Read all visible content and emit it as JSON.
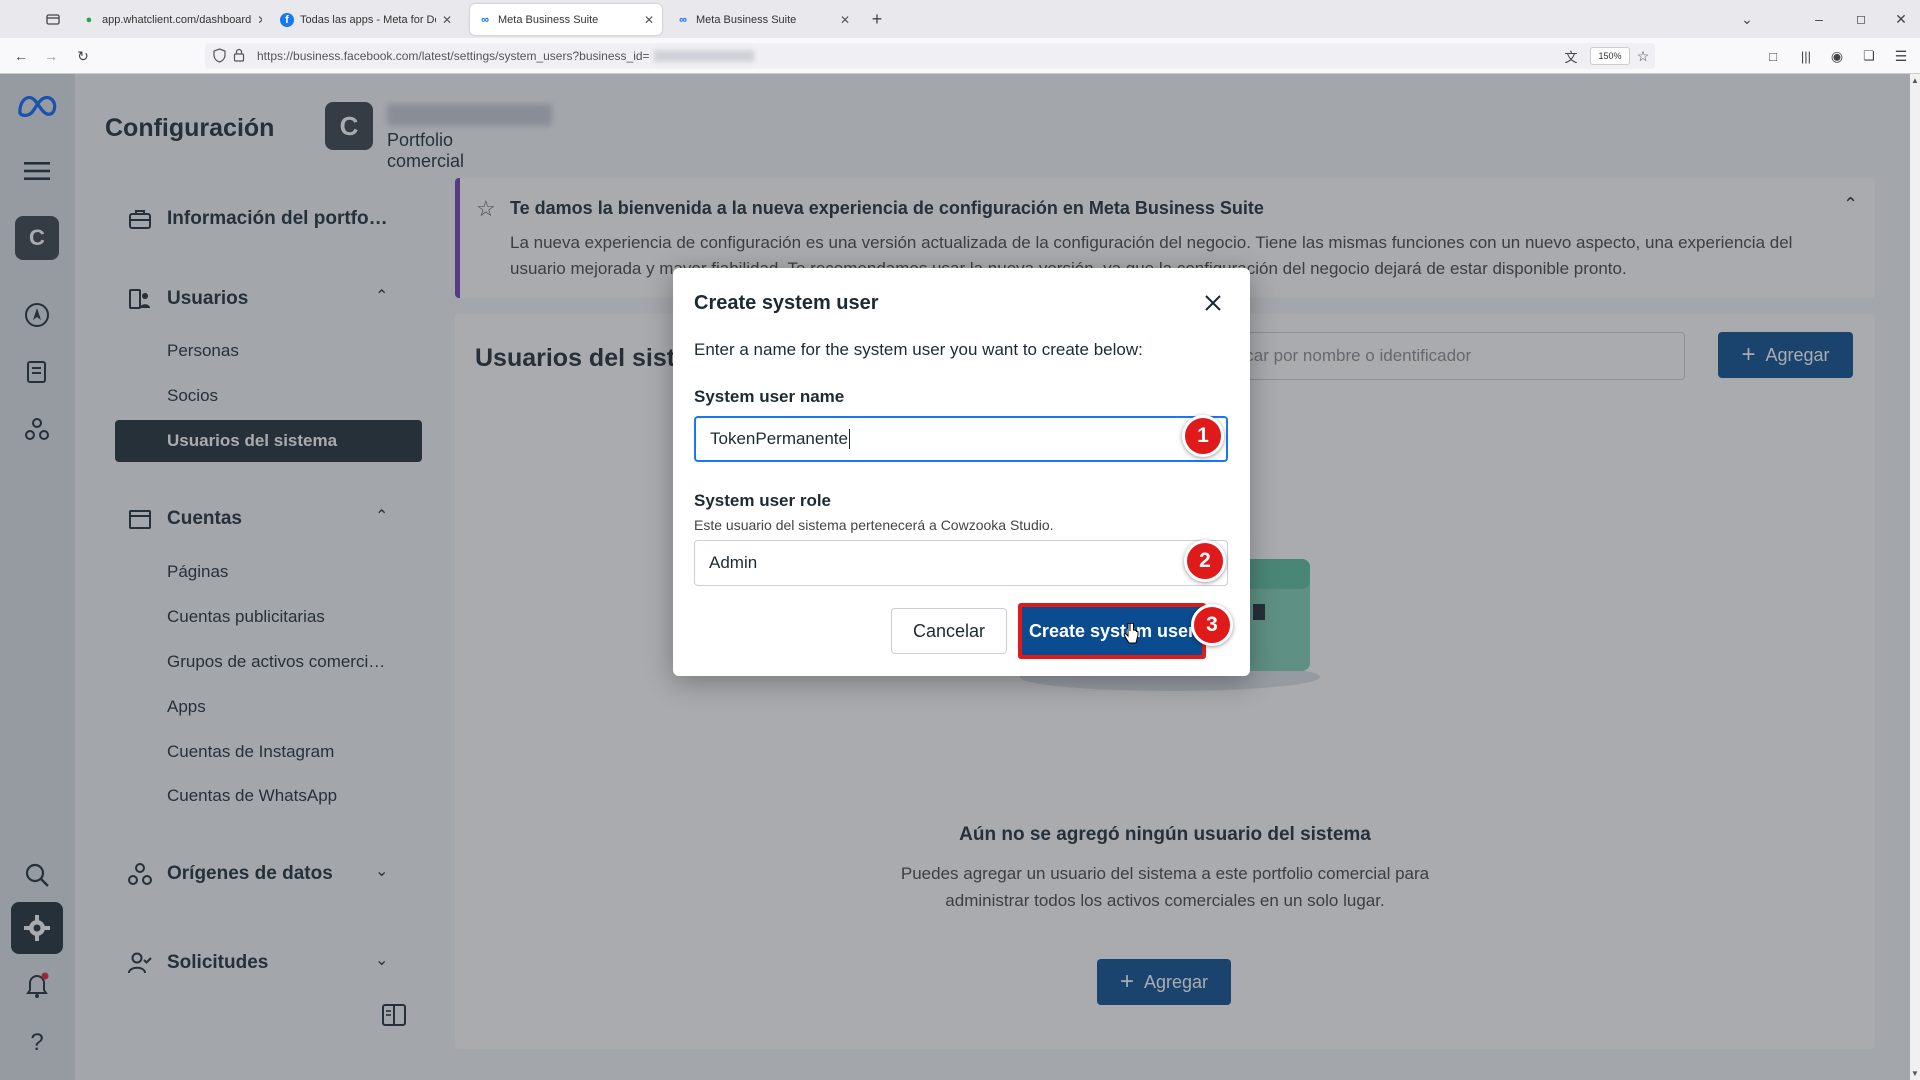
{
  "browser": {
    "tabs": [
      {
        "title": "app.whatclient.com/dashboard",
        "active": false
      },
      {
        "title": "Todas las apps - Meta for Devel…",
        "active": false
      },
      {
        "title": "Meta Business Suite",
        "active": true
      },
      {
        "title": "Meta Business Suite",
        "active": false
      }
    ],
    "url": "https://business.facebook.com/latest/settings/system_users?business_id=",
    "zoom": "150%"
  },
  "header": {
    "title": "Configuración",
    "business_initial": "C",
    "business_subtitle": "Portfolio comercial"
  },
  "rail": {
    "business_initial": "C"
  },
  "sidebar": {
    "info": "Información del portfo…",
    "users": {
      "label": "Usuarios",
      "items": [
        "Personas",
        "Socios",
        "Usuarios del sistema"
      ]
    },
    "accounts": {
      "label": "Cuentas",
      "items": [
        "Páginas",
        "Cuentas publicitarias",
        "Grupos de activos comerci…",
        "Apps",
        "Cuentas de Instagram",
        "Cuentas de WhatsApp"
      ]
    },
    "data_sources": "Orígenes de datos",
    "requests": "Solicitudes"
  },
  "banner": {
    "title": "Te damos la bienvenida a la nueva experiencia de configuración en Meta Business Suite",
    "text": "La nueva experiencia de configuración es una versión actualizada de la configuración del negocio. Tiene las mismas funciones con un nuevo aspecto, una experiencia del usuario mejorada y mayor fiabilidad. Te recomendamos usar la nueva versión, ya que la configuración del negocio dejará de estar disponible pronto."
  },
  "panel": {
    "title": "Usuarios del sistema",
    "search_placeholder": "Buscar por nombre o identificador",
    "add_label": "Agregar",
    "empty_title": "Aún no se agregó ningún usuario del sistema",
    "empty_text": "Puedes agregar un usuario del sistema a este portfolio comercial para administrar todos los activos comerciales en un solo lugar.",
    "empty_add_label": "Agregar"
  },
  "modal": {
    "title": "Create system user",
    "description": "Enter a name for the system user you want to create below:",
    "name_label": "System user name",
    "name_value": "TokenPermanente",
    "role_label": "System user role",
    "role_helper": "Este usuario del sistema pertenecerá a Cowzooka Studio.",
    "role_value": "Admin",
    "cancel_label": "Cancelar",
    "create_label": "Create system user"
  },
  "annotations": [
    "1",
    "2",
    "3"
  ],
  "colors": {
    "accent": "#0a4c8f",
    "highlight": "#e01a1a",
    "focus": "#1877f2",
    "banner_border": "#6e3fb6"
  }
}
